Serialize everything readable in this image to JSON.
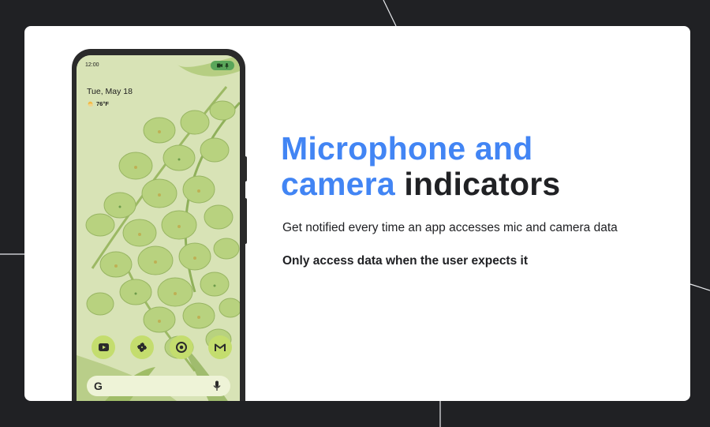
{
  "slide": {
    "headline_blue_1": "Microphone and",
    "headline_blue_2": "camera",
    "headline_dark": "indicators",
    "subtitle": "Get notified every time an app accesses mic and camera data",
    "emphasis": "Only access data when the user expects it"
  },
  "phone": {
    "status_time": "12:00",
    "date": "Tue, May 18",
    "weather_temp": "76°F",
    "privacy_chip_icons": [
      "camera-icon",
      "mic-icon"
    ],
    "dock_apps": [
      "youtube-icon",
      "pinwheel-icon",
      "chrome-icon",
      "gmail-icon"
    ],
    "search_logo": "G",
    "search_mic": "mic-icon"
  },
  "colors": {
    "background": "#202124",
    "card": "#ffffff",
    "accent_blue": "#4285f4",
    "text_dark": "#202124",
    "phone_wallpaper": "#d8e3b6",
    "flower_green": "#b2cf7e",
    "dock_icon_bg": "#c4dd6e",
    "privacy_chip": "#5aa65a"
  }
}
